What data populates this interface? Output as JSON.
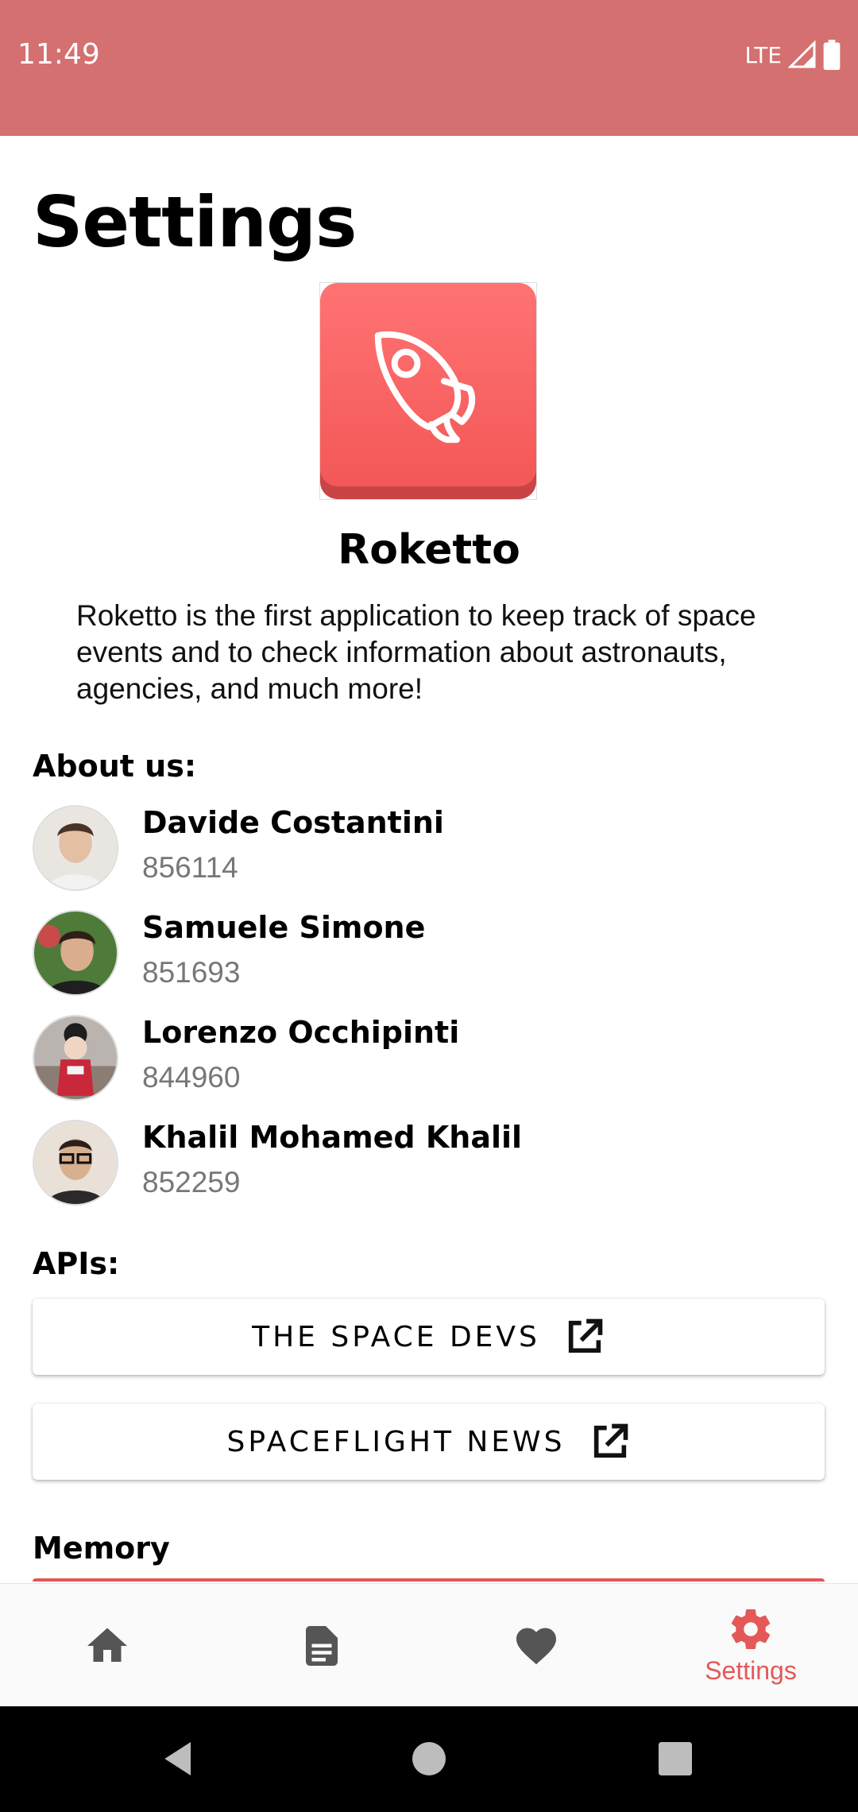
{
  "status_bar": {
    "time": "11:49",
    "network": "LTE",
    "background_color": "#d47070"
  },
  "page": {
    "title": "Settings"
  },
  "app": {
    "name": "Roketto",
    "icon": "rocket-icon",
    "accent_color": "#f35656",
    "description": "Roketto is the first application to keep track of space events and to check information about astronauts, agencies, and much more!"
  },
  "about": {
    "heading": "About us:",
    "members": [
      {
        "name": "Davide Costantini",
        "id": "856114"
      },
      {
        "name": "Samuele Simone",
        "id": "851693"
      },
      {
        "name": "Lorenzo Occhipinti",
        "id": "844960"
      },
      {
        "name": "Khalil Mohamed Khalil",
        "id": "852259"
      }
    ]
  },
  "apis": {
    "heading": "APIs:",
    "buttons": [
      {
        "label": "THE SPACE DEVS",
        "icon": "external-link-icon"
      },
      {
        "label": "SPACEFLIGHT NEWS",
        "icon": "external-link-icon"
      }
    ]
  },
  "memory": {
    "heading": "Memory"
  },
  "bottom_nav": {
    "items": [
      {
        "icon": "home-icon",
        "label": ""
      },
      {
        "icon": "article-icon",
        "label": ""
      },
      {
        "icon": "heart-icon",
        "label": ""
      },
      {
        "icon": "gear-icon",
        "label": "Settings",
        "selected": true
      }
    ],
    "selected_color": "#e45858",
    "inactive_color": "#555555"
  },
  "system_nav": {
    "items": [
      "back-icon",
      "home-circle-icon",
      "recents-icon"
    ]
  }
}
